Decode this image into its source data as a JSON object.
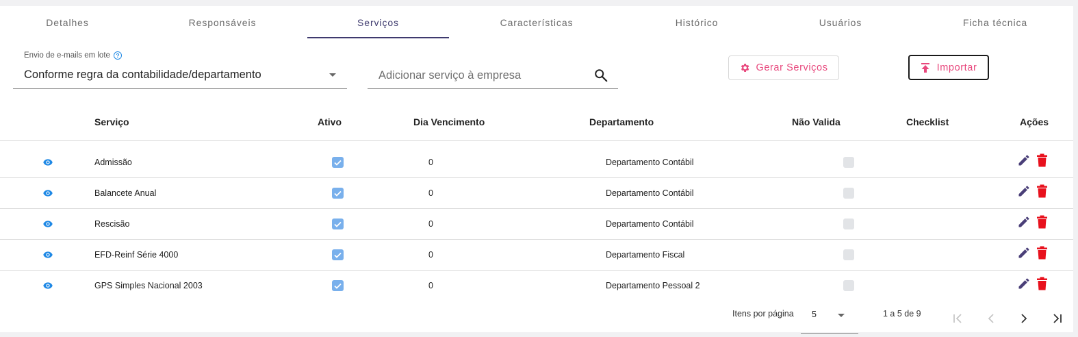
{
  "tabs": [
    {
      "label": "Detalhes"
    },
    {
      "label": "Responsáveis"
    },
    {
      "label": "Serviços",
      "active": true
    },
    {
      "label": "Características"
    },
    {
      "label": "Histórico"
    },
    {
      "label": "Usuários"
    },
    {
      "label": "Ficha técnica"
    }
  ],
  "email_batch": {
    "label": "Envio de e-mails em lote",
    "value": "Conforme regra da contabilidade/departamento"
  },
  "search": {
    "placeholder": "Adicionar serviço à empresa",
    "value": ""
  },
  "actions": {
    "gerar_label": "Gerar Serviços",
    "importar_label": "Importar"
  },
  "table": {
    "headers": {
      "servico": "Serviço",
      "ativo": "Ativo",
      "dia_vencimento": "Dia Vencimento",
      "departamento": "Departamento",
      "nao_valida": "Não Valida",
      "checklist": "Checklist",
      "acoes": "Ações"
    },
    "rows": [
      {
        "servico": "Admissão",
        "ativo": true,
        "dia_vencimento": "0",
        "departamento": "Departamento Contábil",
        "nao_valida": false
      },
      {
        "servico": "Balancete Anual",
        "ativo": true,
        "dia_vencimento": "0",
        "departamento": "Departamento Contábil",
        "nao_valida": false
      },
      {
        "servico": "Rescisão",
        "ativo": true,
        "dia_vencimento": "0",
        "departamento": "Departamento Contábil",
        "nao_valida": false
      },
      {
        "servico": "EFD-Reinf Série 4000",
        "ativo": true,
        "dia_vencimento": "0",
        "departamento": "Departamento Fiscal",
        "nao_valida": false
      },
      {
        "servico": "GPS Simples Nacional 2003",
        "ativo": true,
        "dia_vencimento": "0",
        "departamento": "Departamento Pessoal 2",
        "nao_valida": false
      }
    ]
  },
  "paginator": {
    "items_label": "Itens por página",
    "page_size": "5",
    "range": "1 a 5 de 9"
  },
  "colors": {
    "accent": "#3e3a6e",
    "pink": "#e8487d",
    "eye_blue": "#1e88e5",
    "checkbox_blue": "#79b0ec",
    "delete_red": "#e8111d",
    "edit_purple": "#4a3f78"
  },
  "icons": {
    "help": "help-circle-icon",
    "search": "search-icon",
    "gear": "gear-icon",
    "upload": "upload-icon",
    "view": "eye-icon",
    "edit": "pencil-icon",
    "delete": "trash-icon",
    "first_page": "first-page-icon",
    "prev_page": "chevron-left-icon",
    "next_page": "chevron-right-icon",
    "last_page": "last-page-icon"
  }
}
